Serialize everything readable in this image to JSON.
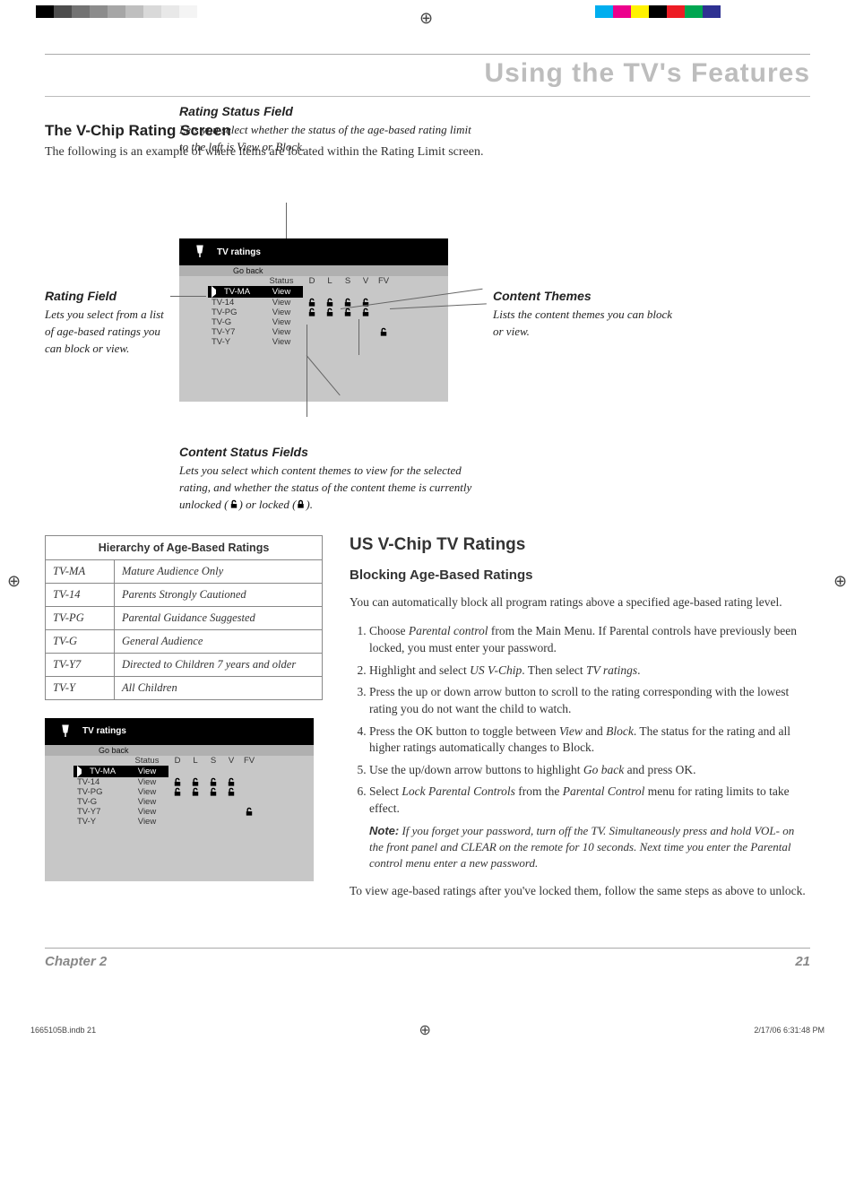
{
  "colorBarsLeft": [
    "#000000",
    "#4d4d4d",
    "#737373",
    "#8c8c8c",
    "#a6a6a6",
    "#bfbfbf",
    "#d9d9d9",
    "#e8e8e8",
    "#f4f4f4",
    "#ffffff"
  ],
  "colorBarsRight": [
    "#00aeef",
    "#ec008c",
    "#fff200",
    "#000000",
    "#ed1c24",
    "#00a651",
    "#2e3192"
  ],
  "chapterTitle": "Using the TV's Features",
  "sectionTitle": "The V-Chip Rating Screen",
  "sectionIntro": "The following is an example of where items are located within the Rating Limit screen.",
  "callouts": {
    "ratingStatus": {
      "title": "Rating Status Field",
      "body": "Lets you select whether the status of the age-based rating limit to the left is View or Block."
    },
    "ratingField": {
      "title": "Rating Field",
      "body": "Lets you select from a list of age-based ratings you can block or view."
    },
    "contentThemes": {
      "title": "Content Themes",
      "body": "Lists the content themes you can block or view."
    },
    "contentStatus": {
      "title": "Content Status Fields",
      "body1": "Lets you select which content themes to view for the selected rating, and whether the status of the content theme is currently unlocked (",
      "body2": ") or locked (",
      "body3": ")."
    }
  },
  "screen": {
    "title": "TV ratings",
    "goBack": "Go back",
    "headers": {
      "status": "Status",
      "d": "D",
      "l": "L",
      "s": "S",
      "v": "V",
      "fv": "FV"
    },
    "rows": [
      {
        "label": "TV-MA",
        "status": "View",
        "sel": true,
        "d": false,
        "l": false,
        "s": false,
        "v": false,
        "fv": false
      },
      {
        "label": "TV-14",
        "status": "View",
        "sel": false,
        "d": true,
        "l": true,
        "s": true,
        "v": true,
        "fv": false
      },
      {
        "label": "TV-PG",
        "status": "View",
        "sel": false,
        "d": true,
        "l": true,
        "s": true,
        "v": true,
        "fv": false
      },
      {
        "label": "TV-G",
        "status": "View",
        "sel": false,
        "d": false,
        "l": false,
        "s": false,
        "v": false,
        "fv": false
      },
      {
        "label": "TV-Y7",
        "status": "View",
        "sel": false,
        "d": false,
        "l": false,
        "s": false,
        "v": false,
        "fv": true
      },
      {
        "label": "TV-Y",
        "status": "View",
        "sel": false,
        "d": false,
        "l": false,
        "s": false,
        "v": false,
        "fv": false
      }
    ]
  },
  "hierarchy": {
    "title": "Hierarchy of Age-Based Ratings",
    "rows": [
      {
        "code": "TV-MA",
        "desc": "Mature Audience Only"
      },
      {
        "code": "TV-14",
        "desc": "Parents Strongly Cautioned"
      },
      {
        "code": "TV-PG",
        "desc": "Parental Guidance Suggested"
      },
      {
        "code": "TV-G",
        "desc": "General Audience"
      },
      {
        "code": "TV-Y7",
        "desc": "Directed to Children 7 years and older"
      },
      {
        "code": "TV-Y",
        "desc": "All Children"
      }
    ]
  },
  "usSection": {
    "title": "US V-Chip TV Ratings",
    "subtitle": "Blocking Age-Based Ratings",
    "intro": "You can automatically block all program ratings above a specified age-based rating level.",
    "note": "If you forget your password, turn off the TV. Simultaneously press and hold VOL- on the front panel and CLEAR on the remote for 10 seconds. Next time you enter the Parental control menu enter a new password.",
    "noteLabel": "Note:",
    "closing": "To view age-based ratings after you've locked them, follow the same steps as above to unlock."
  },
  "footer": {
    "chapter": "Chapter 2",
    "page": "21"
  },
  "printFooter": {
    "file": "1665105B.indb   21",
    "stamp": "2/17/06   6:31:48 PM"
  }
}
